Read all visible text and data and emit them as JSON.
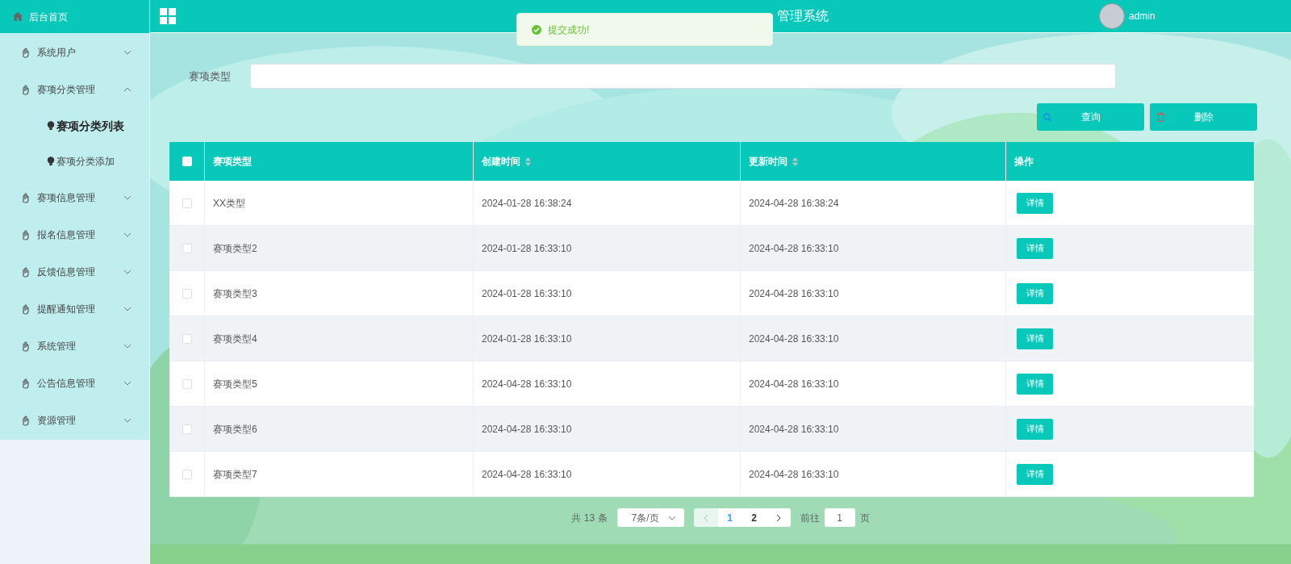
{
  "sidebar": {
    "home": "后台首页",
    "items": [
      {
        "label": "系统用户",
        "expanded": false
      },
      {
        "label": "赛项分类管理",
        "expanded": true,
        "children": [
          {
            "label": "赛项分类列表",
            "selected": true
          },
          {
            "label": "赛项分类添加",
            "selected": false
          }
        ]
      },
      {
        "label": "赛项信息管理",
        "expanded": false
      },
      {
        "label": "报名信息管理",
        "expanded": false
      },
      {
        "label": "反馈信息管理",
        "expanded": false
      },
      {
        "label": "提醒通知管理",
        "expanded": false
      },
      {
        "label": "系统管理",
        "expanded": false
      },
      {
        "label": "公告信息管理",
        "expanded": false
      },
      {
        "label": "资源管理",
        "expanded": false
      }
    ]
  },
  "header": {
    "title": "管理系统",
    "user": "admin"
  },
  "toast": {
    "message": "提交成功!"
  },
  "search": {
    "label": "赛项类型"
  },
  "buttons": [
    {
      "kind": "search",
      "label": "查询"
    },
    {
      "kind": "delete",
      "label": "删除"
    }
  ],
  "table": {
    "all_checked": false,
    "columns": [
      {
        "label": "赛项类型",
        "sortable": false
      },
      {
        "label": "创建时间",
        "sortable": true
      },
      {
        "label": "更新时间",
        "sortable": true
      },
      {
        "label": "操作",
        "sortable": false
      }
    ],
    "rows": [
      {
        "checked": false,
        "cells": [
          "XX类型",
          "2024-01-28 16:38:24",
          "2024-04-28 16:38:24"
        ],
        "action": "详情"
      },
      {
        "checked": false,
        "cells": [
          "赛项类型2",
          "2024-01-28 16:33:10",
          "2024-04-28 16:33:10"
        ],
        "action": "详情"
      },
      {
        "checked": false,
        "cells": [
          "赛项类型3",
          "2024-01-28 16:33:10",
          "2024-04-28 16:33:10"
        ],
        "action": "详情"
      },
      {
        "checked": false,
        "cells": [
          "赛项类型4",
          "2024-01-28 16:33:10",
          "2024-04-28 16:33:10"
        ],
        "action": "详情"
      },
      {
        "checked": false,
        "cells": [
          "赛项类型5",
          "2024-04-28 16:33:10",
          "2024-04-28 16:33:10"
        ],
        "action": "详情"
      },
      {
        "checked": false,
        "cells": [
          "赛项类型6",
          "2024-04-28 16:33:10",
          "2024-04-28 16:33:10"
        ],
        "action": "详情"
      },
      {
        "checked": false,
        "cells": [
          "赛项类型7",
          "2024-04-28 16:33:10",
          "2024-04-28 16:33:10"
        ],
        "action": "详情"
      }
    ]
  },
  "pagination": {
    "total": "共 13 条",
    "page_size": "7条/页",
    "pages": [
      {
        "label": "1",
        "selected": true
      },
      {
        "label": "2",
        "selected": false
      }
    ],
    "goto_label": "前往",
    "goto_value": "1",
    "page_suffix": "页"
  }
}
